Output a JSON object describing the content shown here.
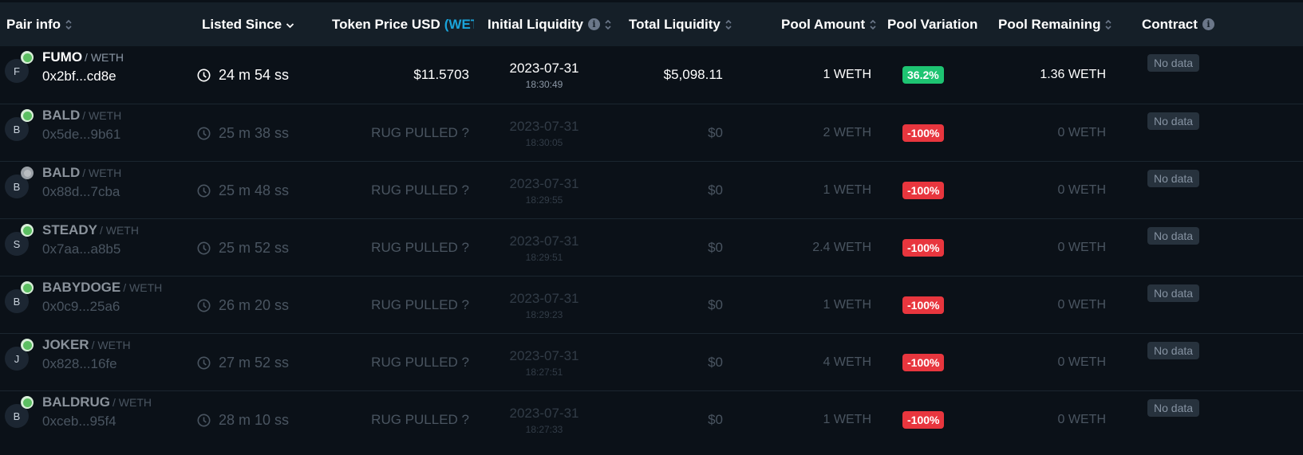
{
  "header": {
    "columns": [
      {
        "label": "Pair info",
        "icon": "sort-icon"
      },
      {
        "label": "Listed Since",
        "icon": "chevron-down-icon"
      },
      {
        "label": "Token Price USD",
        "accent": "(WETH",
        "accent_color": "#1aa3d9"
      },
      {
        "label": "Initial Liquidity",
        "icon": "info-icon",
        "icon2": "sort-icon"
      },
      {
        "label": "Total Liquidity",
        "icon": "sort-icon"
      },
      {
        "label": "Pool Amount",
        "icon": "sort-icon"
      },
      {
        "label": "Pool Variation"
      },
      {
        "label": "Pool Remaining",
        "icon": "sort-icon"
      },
      {
        "label": "Contract",
        "icon": "info-icon"
      }
    ]
  },
  "colors": {
    "positive": "#1ec472",
    "negative": "#e8363e",
    "accent": "#1aa3d9"
  },
  "rows": [
    {
      "avatar": "F",
      "chain": "green",
      "symbol": "FUMO",
      "quote": "/ WETH",
      "address": "0x2bf...cd8e",
      "since": "24 m 54 ss",
      "price": "$11.5703",
      "init_date": "2023-07-31",
      "init_time": "18:30:49",
      "total": "$5,098.11",
      "pool_amount": "1 WETH",
      "variation": "36.2%",
      "variation_type": "green",
      "remaining": "1.36 WETH",
      "contract": "No data",
      "state": "active"
    },
    {
      "avatar": "B",
      "chain": "green",
      "symbol": "BALD",
      "quote": "/ WETH",
      "address": "0x5de...9b61",
      "since": "25 m 38 ss",
      "price": "RUG PULLED ?",
      "init_date": "2023-07-31",
      "init_time": "18:30:05",
      "total": "$0",
      "pool_amount": "2 WETH",
      "variation": "-100%",
      "variation_type": "red",
      "remaining": "0 WETH",
      "contract": "No data",
      "state": "faded"
    },
    {
      "avatar": "B",
      "chain": "gray",
      "symbol": "BALD",
      "quote": "/ WETH",
      "address": "0x88d...7cba",
      "since": "25 m 48 ss",
      "price": "RUG PULLED ?",
      "init_date": "2023-07-31",
      "init_time": "18:29:55",
      "total": "$0",
      "pool_amount": "1 WETH",
      "variation": "-100%",
      "variation_type": "red",
      "remaining": "0 WETH",
      "contract": "No data",
      "state": "faded"
    },
    {
      "avatar": "S",
      "chain": "green",
      "symbol": "STEADY",
      "quote": "/ WETH",
      "address": "0x7aa...a8b5",
      "since": "25 m 52 ss",
      "price": "RUG PULLED ?",
      "init_date": "2023-07-31",
      "init_time": "18:29:51",
      "total": "$0",
      "pool_amount": "2.4 WETH",
      "variation": "-100%",
      "variation_type": "red",
      "remaining": "0 WETH",
      "contract": "No data",
      "state": "faded"
    },
    {
      "avatar": "B",
      "chain": "green",
      "symbol": "BABYDOGE",
      "quote": "/ WETH",
      "address": "0x0c9...25a6",
      "since": "26 m 20 ss",
      "price": "RUG PULLED ?",
      "init_date": "2023-07-31",
      "init_time": "18:29:23",
      "total": "$0",
      "pool_amount": "1 WETH",
      "variation": "-100%",
      "variation_type": "red",
      "remaining": "0 WETH",
      "contract": "No data",
      "state": "faded"
    },
    {
      "avatar": "J",
      "chain": "green",
      "symbol": "JOKER",
      "quote": "/ WETH",
      "address": "0x828...16fe",
      "since": "27 m 52 ss",
      "price": "RUG PULLED ?",
      "init_date": "2023-07-31",
      "init_time": "18:27:51",
      "total": "$0",
      "pool_amount": "4 WETH",
      "variation": "-100%",
      "variation_type": "red",
      "remaining": "0 WETH",
      "contract": "No data",
      "state": "faded"
    },
    {
      "avatar": "B",
      "chain": "green",
      "symbol": "BALDRUG",
      "quote": "/ WETH",
      "address": "0xceb...95f4",
      "since": "28 m 10 ss",
      "price": "RUG PULLED ?",
      "init_date": "2023-07-31",
      "init_time": "18:27:33",
      "total": "$0",
      "pool_amount": "1 WETH",
      "variation": "-100%",
      "variation_type": "red",
      "remaining": "0 WETH",
      "contract": "No data",
      "state": "faded"
    }
  ]
}
